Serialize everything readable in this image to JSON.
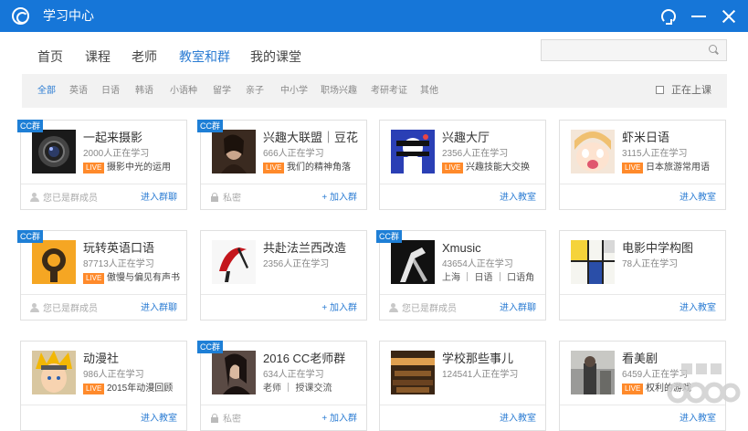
{
  "app": {
    "title": "学习中心"
  },
  "titlebar": {
    "icons": [
      "headset-icon",
      "minimize-icon",
      "close-icon"
    ]
  },
  "nav": {
    "tabs": [
      "首页",
      "课程",
      "老师",
      "教室和群",
      "我的课堂"
    ],
    "active": "教室和群"
  },
  "search": {
    "placeholder": "",
    "icon": "search-icon"
  },
  "filters": {
    "items": [
      "全部",
      "英语",
      "日语",
      "韩语",
      "小语种",
      "留学",
      "亲子",
      "中小学",
      "职场兴趣",
      "考研考证",
      "其他"
    ],
    "active": "全部",
    "online_only": "正在上课",
    "online_checked": false
  },
  "colors": {
    "accent": "#1676d8",
    "live": "#ff8a2b",
    "link": "#2b7cd3",
    "cc_tag": "#1e7fd6"
  },
  "cards": [
    {
      "cc": "CC群",
      "title": "一起来摄影",
      "count": "2000人正在学习",
      "live": "LIVE",
      "live_text": "摄影中光的运用",
      "tags": "",
      "status": "您已是群成员",
      "action": "进入群聊"
    },
    {
      "cc": "CC群",
      "title": "兴趣大联盟｜豆花",
      "count": "666人正在学习",
      "live": "LIVE",
      "live_text": "我们的精神角落",
      "tags": "",
      "status": "私密",
      "action": "+ 加入群"
    },
    {
      "cc": "",
      "title": "兴趣大厅",
      "count": "2356人正在学习",
      "live": "LIVE",
      "live_text": "兴趣技能大交换",
      "tags": "",
      "status": "",
      "action": "进入教室"
    },
    {
      "cc": "",
      "title": "虾米日语",
      "count": "3115人正在学习",
      "live": "LIVE",
      "live_text": "日本旅游常用语",
      "tags": "",
      "status": "",
      "action": "进入教室"
    },
    {
      "cc": "CC群",
      "title": "玩转英语口语",
      "count": "87713人正在学习",
      "live": "LIVE",
      "live_text": "傲慢与偏见有声书",
      "tags": "",
      "status": "您已是群成员",
      "action": "进入群聊"
    },
    {
      "cc": "",
      "title": "共赴法兰西改造",
      "count": "2356人正在学习",
      "live": "",
      "live_text": "",
      "tags": "",
      "status": "",
      "action": "+ 加入群"
    },
    {
      "cc": "CC群",
      "title": "Xmusic",
      "count": "43654人正在学习",
      "live": "",
      "live_text": "",
      "tags": "上海 ｜ 日语 ｜ 口语角",
      "status": "您已是群成员",
      "action": "进入群聊"
    },
    {
      "cc": "",
      "title": "电影中学构图",
      "count": "78人正在学习",
      "live": "",
      "live_text": "",
      "tags": "",
      "status": "",
      "action": "进入教室"
    },
    {
      "cc": "",
      "title": "动漫社",
      "count": "986人正在学习",
      "live": "LIVE",
      "live_text": "2015年动漫回顾",
      "tags": "",
      "status": "",
      "action": "进入教室"
    },
    {
      "cc": "CC群",
      "title": "2016 CC老师群",
      "count": "634人正在学习",
      "live": "",
      "live_text": "",
      "tags": "老师 ｜ 授课交流",
      "status": "私密",
      "action": "+ 加入群"
    },
    {
      "cc": "",
      "title": "学校那些事儿",
      "count": "124541人正在学习",
      "live": "",
      "live_text": "",
      "tags": "",
      "status": "",
      "action": "进入教室"
    },
    {
      "cc": "",
      "title": "看美剧",
      "count": "6459人正在学习",
      "live": "LIVE",
      "live_text": "权利的游戏",
      "tags": "",
      "status": "",
      "action": "进入教室"
    }
  ]
}
